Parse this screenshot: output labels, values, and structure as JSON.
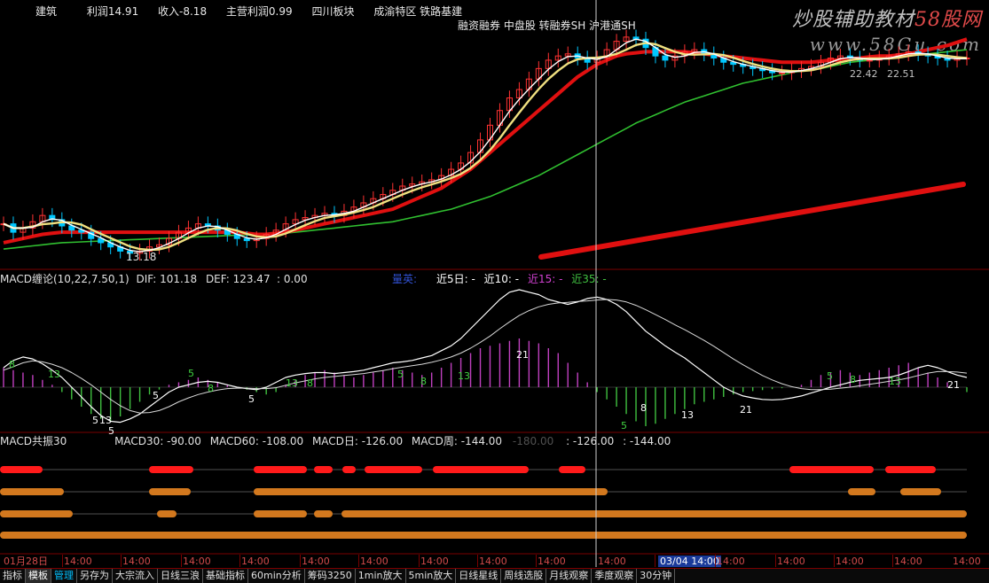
{
  "header": {
    "items": [
      "建筑",
      "利润14.91",
      "收入-8.18",
      "主营利润0.99",
      "四川板块",
      "成渝特区 铁路基建"
    ],
    "tags": "融资融券 中盘股 转融券SH 沪港通SH",
    "watermark_line1_a": "炒股辅助教材",
    "watermark_line1_b": "58股网",
    "watermark_line2": "www.58Gu.com"
  },
  "price_panel": {
    "low_label": "13.18",
    "tail_label_a": "22.42",
    "tail_label_b": "22.51"
  },
  "macd_panel": {
    "title": "MACD缠论(10,22,7.50,1)",
    "dif": "DIF: 101.18",
    "def": "DEF: 123.47",
    "zero": ": 0.00",
    "extra": "量英:",
    "near5": "近5日: -",
    "near10": "近10: -",
    "near15": "近15: -",
    "near35": "近35: -",
    "labels": [
      {
        "t": "8",
        "c": "green"
      },
      {
        "t": "13",
        "c": "green"
      },
      {
        "t": "13",
        "c": "white"
      },
      {
        "t": "5",
        "c": "white"
      },
      {
        "t": "5",
        "c": "green"
      },
      {
        "t": "8",
        "c": "green"
      },
      {
        "t": "13",
        "c": "green"
      },
      {
        "t": "5",
        "c": "white"
      },
      {
        "t": "8",
        "c": "green"
      },
      {
        "t": "5",
        "c": "green"
      },
      {
        "t": "8",
        "c": "green"
      },
      {
        "t": "13",
        "c": "green"
      },
      {
        "t": "21",
        "c": "white"
      },
      {
        "t": "5",
        "c": "green"
      },
      {
        "t": "8",
        "c": "white"
      },
      {
        "t": "13",
        "c": "white"
      },
      {
        "t": "21",
        "c": "white"
      },
      {
        "t": "5",
        "c": "green"
      },
      {
        "t": "8",
        "c": "green"
      },
      {
        "t": "13",
        "c": "green"
      },
      {
        "t": "21",
        "c": "white"
      },
      {
        "t": "5",
        "c": "white"
      },
      {
        "t": "5",
        "c": "white"
      }
    ]
  },
  "resonance_panel": {
    "title": "MACD共振30",
    "m30": "MACD30: -90.00",
    "m60": "MACD60: -108.00",
    "mday": "MACD日: -126.00",
    "mweek": "MACD周: -144.00",
    "dim": "-180.00",
    "r1": ": -126.00",
    "r2": ": -144.00",
    "rows": [
      [
        [
          0,
          48
        ],
        [
          168,
          218
        ],
        [
          286,
          346
        ],
        [
          354,
          375
        ],
        [
          386,
          401
        ],
        [
          411,
          476
        ],
        [
          488,
          596
        ],
        [
          630,
          660
        ],
        [
          890,
          985
        ],
        [
          998,
          1055
        ]
      ],
      [
        [
          0,
          72
        ],
        [
          168,
          215
        ],
        [
          286,
          685
        ],
        [
          956,
          987
        ],
        [
          1015,
          1061
        ]
      ],
      [
        [
          0,
          82
        ],
        [
          177,
          199
        ],
        [
          286,
          346
        ],
        [
          354,
          375
        ],
        [
          385,
          1090
        ]
      ],
      [
        [
          0,
          1090
        ]
      ]
    ],
    "row_colors": [
      "#ff1a1a",
      "#d2781e",
      "#d2781e",
      "#d2781e"
    ]
  },
  "time_axis": {
    "labels": [
      "01月28日",
      "14:00",
      "14:00",
      "14:00",
      "14:00",
      "14:00",
      "14:00",
      "14:00",
      "14:00",
      "14:00",
      "14:00",
      "03/04 14:00",
      "14:00",
      "14:00",
      "14:00",
      "14:00",
      "14:00",
      "14:00",
      "14:00"
    ],
    "cursor_label": "03/04 14:00"
  },
  "tabs": [
    {
      "label": "指标",
      "state": "normal"
    },
    {
      "label": "模板",
      "state": "active"
    },
    {
      "label": "管理",
      "state": "hl"
    },
    {
      "label": "另存为",
      "state": "normal"
    },
    {
      "label": "大宗流入",
      "state": "normal"
    },
    {
      "label": "日线三浪",
      "state": "normal"
    },
    {
      "label": "基础指标",
      "state": "normal"
    },
    {
      "label": "60min分析",
      "state": "normal"
    },
    {
      "label": "筹码3250",
      "state": "normal"
    },
    {
      "label": "1min放大",
      "state": "normal"
    },
    {
      "label": "5min放大",
      "state": "normal"
    },
    {
      "label": "日线星线",
      "state": "normal"
    },
    {
      "label": "周线选股",
      "state": "normal"
    },
    {
      "label": "月线观察",
      "state": "normal"
    },
    {
      "label": "季度观察",
      "state": "normal"
    },
    {
      "label": "30分钟",
      "state": "normal"
    }
  ],
  "colors": {
    "up": "#ff3232",
    "down": "#00c8ff",
    "ma_long": "#e01010",
    "ma_green": "#30c030",
    "ma_white": "#ffffff",
    "ma_yellow": "#f0e080",
    "macd_pos": "#c040c0",
    "macd_neg": "#40c040",
    "grid": "#7a0000"
  },
  "chart_data": {
    "type": "line",
    "x_count": 100,
    "close": [
      14.6,
      14.2,
      14.4,
      14.7,
      15.0,
      14.8,
      14.5,
      14.3,
      14.2,
      13.9,
      13.7,
      13.5,
      13.3,
      13.2,
      13.3,
      13.5,
      13.6,
      13.9,
      14.2,
      14.4,
      14.6,
      14.5,
      14.3,
      14.1,
      13.9,
      13.8,
      13.9,
      14.1,
      14.3,
      14.6,
      14.8,
      14.9,
      15.0,
      15.1,
      15.0,
      15.2,
      15.4,
      15.6,
      15.8,
      16.0,
      16.2,
      16.4,
      16.5,
      16.6,
      16.7,
      16.9,
      17.2,
      17.5,
      18.0,
      18.6,
      19.3,
      20.0,
      20.6,
      21.0,
      21.5,
      22.0,
      22.4,
      22.6,
      22.7,
      22.5,
      22.3,
      22.5,
      22.9,
      23.3,
      23.5,
      23.4,
      23.0,
      22.6,
      22.4,
      22.6,
      22.8,
      22.9,
      22.7,
      22.5,
      22.3,
      22.2,
      22.1,
      22.0,
      21.9,
      21.8,
      21.8,
      21.9,
      22.0,
      22.1,
      22.3,
      22.5,
      22.6,
      22.5,
      22.4,
      22.4,
      22.5,
      22.6,
      22.7,
      22.8,
      22.7,
      22.6,
      22.5,
      22.4,
      22.5,
      22.5
    ],
    "ma_long": [
      13.7,
      13.8,
      13.9,
      14.0,
      14.1,
      14.15,
      14.2,
      14.2,
      14.2,
      14.2,
      14.2,
      14.2,
      14.2,
      14.2,
      14.2,
      14.2,
      14.2,
      14.2,
      14.2,
      14.2,
      14.2,
      14.2,
      14.2,
      14.2,
      14.2,
      14.15,
      14.1,
      14.1,
      14.15,
      14.2,
      14.3,
      14.4,
      14.5,
      14.6,
      14.7,
      14.8,
      14.9,
      15.0,
      15.1,
      15.2,
      15.3,
      15.5,
      15.7,
      15.9,
      16.1,
      16.3,
      16.6,
      16.9,
      17.2,
      17.6,
      18.0,
      18.4,
      18.8,
      19.2,
      19.6,
      20.0,
      20.4,
      20.8,
      21.2,
      21.6,
      21.9,
      22.2,
      22.4,
      22.6,
      22.7,
      22.75,
      22.8,
      22.8,
      22.8,
      22.8,
      22.8,
      22.75,
      22.7,
      22.65,
      22.6,
      22.55,
      22.5,
      22.45,
      22.4,
      22.35,
      22.3,
      22.3,
      22.3,
      22.3,
      22.35,
      22.4,
      22.4,
      22.45,
      22.5,
      22.55,
      22.6,
      22.6,
      22.65,
      22.7,
      22.8,
      22.9,
      23.0,
      23.1,
      23.25,
      23.4
    ],
    "ma_green": [
      13.4,
      13.45,
      13.5,
      13.55,
      13.6,
      13.65,
      13.7,
      13.72,
      13.74,
      13.76,
      13.78,
      13.8,
      13.82,
      13.84,
      13.86,
      13.88,
      13.9,
      13.92,
      13.94,
      13.96,
      13.98,
      14.0,
      14.02,
      14.04,
      14.06,
      14.08,
      14.1,
      14.12,
      14.14,
      14.16,
      14.2,
      14.25,
      14.3,
      14.35,
      14.4,
      14.45,
      14.5,
      14.55,
      14.6,
      14.65,
      14.7,
      14.8,
      14.9,
      15.0,
      15.1,
      15.2,
      15.3,
      15.45,
      15.6,
      15.75,
      15.9,
      16.1,
      16.3,
      16.5,
      16.7,
      16.9,
      17.15,
      17.4,
      17.65,
      17.9,
      18.15,
      18.4,
      18.65,
      18.9,
      19.15,
      19.4,
      19.6,
      19.8,
      20.0,
      20.2,
      20.4,
      20.55,
      20.7,
      20.85,
      21.0,
      21.15,
      21.3,
      21.4,
      21.5,
      21.6,
      21.7,
      21.8,
      21.9,
      21.95,
      22.0,
      22.1,
      22.2,
      22.3,
      22.35,
      22.4,
      22.45,
      22.5,
      22.55,
      22.6,
      22.65,
      22.7,
      22.75,
      22.8,
      22.85,
      22.9
    ],
    "macd_hist": [
      40,
      35,
      30,
      25,
      15,
      5,
      -10,
      -25,
      -40,
      -55,
      -65,
      -70,
      -60,
      -45,
      -30,
      -15,
      -5,
      5,
      10,
      15,
      20,
      15,
      10,
      5,
      0,
      -5,
      -10,
      -15,
      -10,
      5,
      15,
      25,
      30,
      35,
      30,
      25,
      20,
      25,
      30,
      35,
      40,
      35,
      30,
      25,
      30,
      40,
      50,
      60,
      70,
      80,
      85,
      90,
      95,
      100,
      95,
      90,
      80,
      70,
      50,
      30,
      10,
      -10,
      -25,
      -40,
      -55,
      -70,
      -80,
      -75,
      -65,
      -55,
      -45,
      -35,
      -30,
      -25,
      -20,
      -15,
      -10,
      -8,
      -6,
      -4,
      -2,
      0,
      5,
      15,
      25,
      30,
      35,
      30,
      25,
      30,
      35,
      40,
      45,
      50,
      40,
      30,
      20,
      10,
      0,
      -10
    ],
    "macd_dif": [
      40,
      55,
      62,
      58,
      48,
      35,
      20,
      0,
      -20,
      -40,
      -58,
      -70,
      -72,
      -65,
      -55,
      -40,
      -25,
      -10,
      0,
      5,
      10,
      12,
      10,
      5,
      0,
      -3,
      -5,
      0,
      10,
      20,
      25,
      28,
      30,
      30,
      28,
      30,
      32,
      35,
      40,
      45,
      50,
      52,
      55,
      60,
      65,
      75,
      85,
      100,
      120,
      140,
      160,
      180,
      195,
      200,
      195,
      190,
      180,
      175,
      170,
      175,
      182,
      185,
      180,
      170,
      155,
      135,
      115,
      100,
      85,
      72,
      60,
      45,
      30,
      15,
      0,
      -10,
      -18,
      -22,
      -25,
      -26,
      -25,
      -22,
      -18,
      -12,
      -6,
      0,
      5,
      10,
      14,
      16,
      18,
      20,
      25,
      32,
      40,
      45,
      40,
      32,
      25,
      20
    ],
    "macd_dea": [
      35,
      42,
      50,
      54,
      52,
      47,
      40,
      30,
      18,
      5,
      -10,
      -25,
      -38,
      -48,
      -53,
      -52,
      -48,
      -40,
      -30,
      -22,
      -15,
      -10,
      -6,
      -3,
      -2,
      -2,
      -3,
      -3,
      -1,
      4,
      9,
      13,
      17,
      20,
      22,
      24,
      26,
      28,
      31,
      34,
      38,
      41,
      44,
      47,
      51,
      56,
      62,
      70,
      80,
      92,
      105,
      120,
      134,
      147,
      157,
      165,
      170,
      173,
      174,
      176,
      177,
      179,
      180,
      179,
      175,
      168,
      159,
      149,
      139,
      128,
      118,
      107,
      96,
      84,
      71,
      58,
      46,
      35,
      24,
      15,
      7,
      1,
      -3,
      -5,
      -5,
      -4,
      -2,
      0,
      3,
      6,
      9,
      12,
      15,
      19,
      24,
      29,
      32,
      32,
      31,
      29
    ]
  }
}
